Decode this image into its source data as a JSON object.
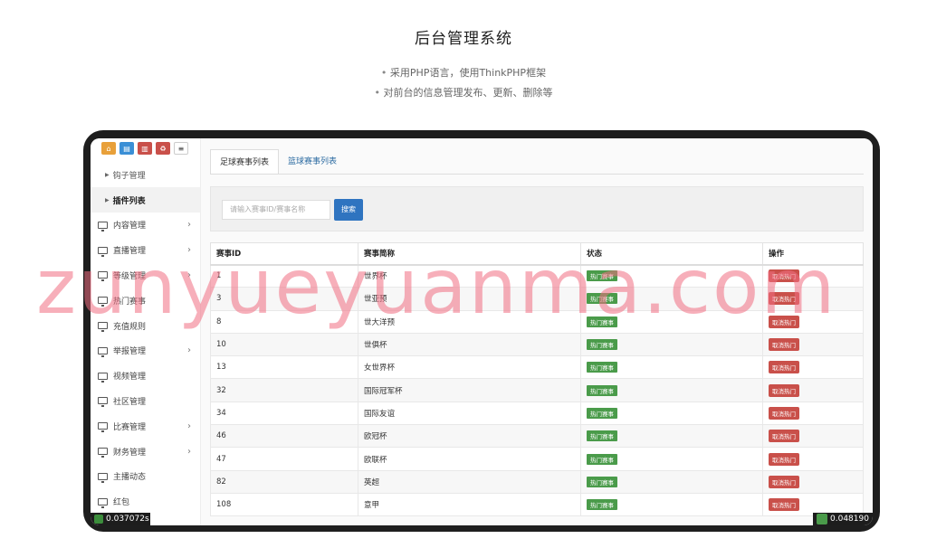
{
  "header": {
    "title": "后台管理系统",
    "bullets": [
      "采用PHP语言，使用ThinkPHP框架",
      "对前台的信息管理发布、更新、删除等"
    ]
  },
  "toolbar": {
    "buttons": [
      {
        "icon": "home-icon",
        "color": "#e8a03a"
      },
      {
        "icon": "file-icon",
        "color": "#3a8fd6"
      },
      {
        "icon": "trash-icon",
        "color": "#c9504a"
      },
      {
        "icon": "recycle-icon",
        "color": "#c9504a"
      },
      {
        "icon": "list-icon",
        "color": "#ffffff"
      }
    ]
  },
  "sidebar": {
    "subitems": [
      {
        "label": "钩子管理",
        "active": false
      },
      {
        "label": "插件列表",
        "active": true
      }
    ],
    "items": [
      {
        "label": "内容管理",
        "chevron": true
      },
      {
        "label": "直播管理",
        "chevron": true
      },
      {
        "label": "等级管理",
        "chevron": true
      },
      {
        "label": "热门赛事",
        "chevron": false
      },
      {
        "label": "充值规则",
        "chevron": false
      },
      {
        "label": "举报管理",
        "chevron": true
      },
      {
        "label": "视频管理",
        "chevron": false
      },
      {
        "label": "社区管理",
        "chevron": false
      },
      {
        "label": "比赛管理",
        "chevron": true
      },
      {
        "label": "财务管理",
        "chevron": true
      },
      {
        "label": "主播动态",
        "chevron": false
      },
      {
        "label": "红包",
        "chevron": false
      }
    ],
    "timer": "0.037072s"
  },
  "main": {
    "tabs": [
      "足球赛事列表",
      "篮球赛事列表"
    ],
    "search": {
      "placeholder": "请输入赛事ID/赛事名称",
      "button": "搜索"
    },
    "table": {
      "headers": [
        "赛事ID",
        "赛事简称",
        "状态",
        "操作"
      ],
      "status_label": "热门赛事",
      "action_label": "取消热门",
      "rows": [
        {
          "id": "1",
          "name": "世界杯"
        },
        {
          "id": "3",
          "name": "世亚预"
        },
        {
          "id": "8",
          "name": "世大洋预"
        },
        {
          "id": "10",
          "name": "世俱杯"
        },
        {
          "id": "13",
          "name": "女世界杯"
        },
        {
          "id": "32",
          "name": "国际冠军杯"
        },
        {
          "id": "34",
          "name": "国际友谊"
        },
        {
          "id": "46",
          "name": "欧冠杯"
        },
        {
          "id": "47",
          "name": "欧联杯"
        },
        {
          "id": "82",
          "name": "英超"
        },
        {
          "id": "108",
          "name": "意甲"
        }
      ]
    },
    "timer": "0.048190"
  },
  "watermark": "zunyueyuanma.com"
}
